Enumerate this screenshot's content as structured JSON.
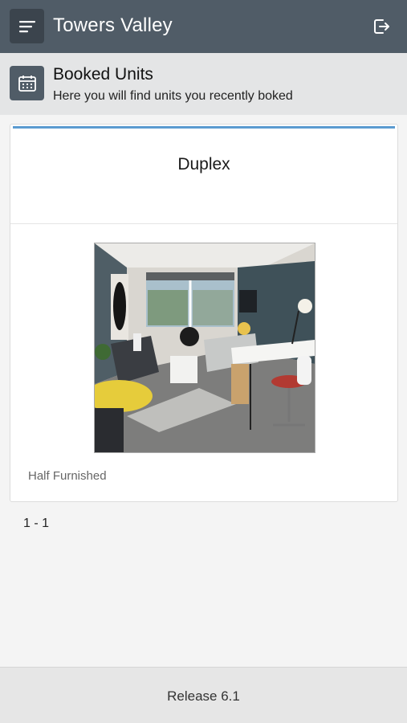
{
  "app": {
    "title": "Towers Valley"
  },
  "icons": {
    "menu": "menu-icon",
    "logout": "logout-icon",
    "header": "calendar-icon"
  },
  "page_header": {
    "title": "Booked Units",
    "subtitle": "Here you will find units you recently boked"
  },
  "units": [
    {
      "name": "Duplex",
      "furnishing": "Half Furnished"
    }
  ],
  "pagination": {
    "range": "1 - 1"
  },
  "footer": {
    "release": "Release 6.1"
  },
  "colors": {
    "topbar": "#505c67",
    "accent": "#5b9bd0",
    "header_band": "#e4e5e6"
  }
}
